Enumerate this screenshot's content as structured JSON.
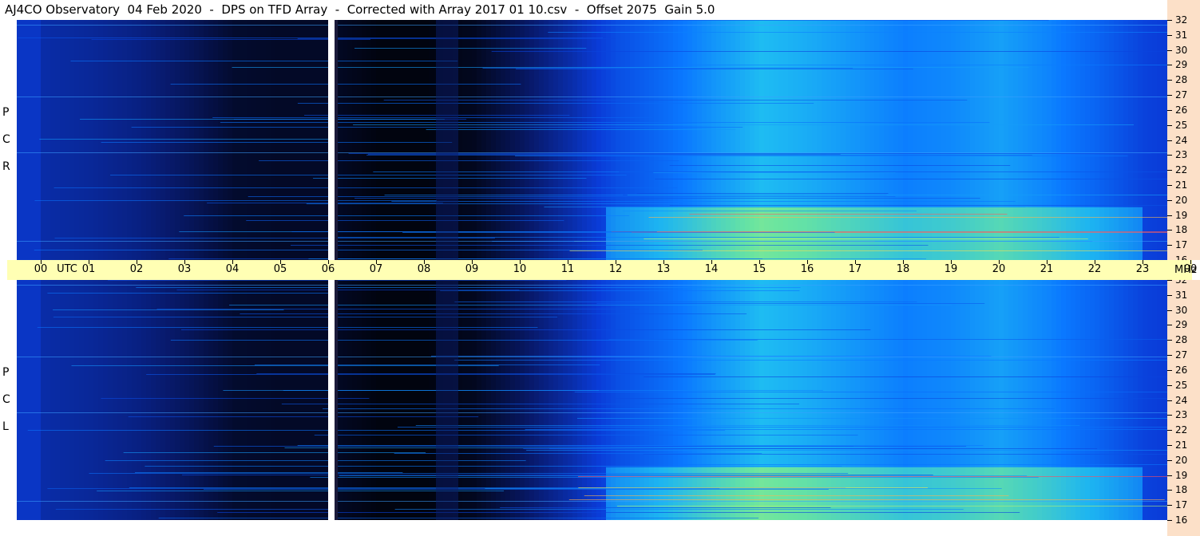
{
  "title": "AJ4CO Observatory  04 Feb 2020  -  DPS on TFD Array  -  Corrected with Array 2017 01 10.csv  -  Offset 2075  Gain 5.0",
  "top_panel": {
    "polarization": [
      "R",
      "C",
      "P"
    ]
  },
  "bottom_panel": {
    "polarization": [
      "L",
      "C",
      "P"
    ]
  },
  "utc_axis": {
    "unit_label": "UTC",
    "ticks": [
      "00",
      "01",
      "02",
      "03",
      "04",
      "05",
      "06",
      "07",
      "08",
      "09",
      "10",
      "11",
      "12",
      "13",
      "14",
      "15",
      "16",
      "17",
      "18",
      "19",
      "20",
      "21",
      "22",
      "23",
      "00"
    ]
  },
  "mhz_axis": {
    "unit_label": "MHz",
    "ticks": [
      "32",
      "31",
      "30",
      "29",
      "28",
      "27",
      "26",
      "25",
      "24",
      "23",
      "22",
      "21",
      "20",
      "19",
      "18",
      "17",
      "16"
    ]
  },
  "chart_data": {
    "type": "heatmap",
    "title": "AJ4CO Observatory  04 Feb 2020  -  DPS on TFD Array  -  Corrected with Array 2017 01 10.csv  -  Offset 2075  Gain 5.0",
    "x_axis": {
      "label": "UTC",
      "range": [
        0,
        24
      ],
      "ticks": [
        "00",
        "01",
        "02",
        "03",
        "04",
        "05",
        "06",
        "07",
        "08",
        "09",
        "10",
        "11",
        "12",
        "13",
        "14",
        "15",
        "16",
        "17",
        "18",
        "19",
        "20",
        "21",
        "22",
        "23",
        "00"
      ]
    },
    "y_axis": {
      "label": "MHz",
      "range": [
        16,
        32
      ],
      "ticks": [
        32,
        31,
        30,
        29,
        28,
        27,
        26,
        25,
        24,
        23,
        22,
        21,
        20,
        19,
        18,
        17,
        16
      ]
    },
    "panels": [
      "RCP",
      "LCP"
    ],
    "colormap": [
      "#000000",
      "#081a6e",
      "#0a3cd8",
      "#0a78ff",
      "#22c8f0",
      "#7cf08c",
      "#f0f050",
      "#ff4060"
    ],
    "data_gap_utc": [
      6.0,
      6.3
    ],
    "intensity_profile_utc": [
      [
        0,
        0.22
      ],
      [
        1,
        0.2
      ],
      [
        2,
        0.17
      ],
      [
        3,
        0.12
      ],
      [
        4,
        0.06
      ],
      [
        5,
        0.05
      ],
      [
        6,
        0.05
      ],
      [
        7,
        0.02
      ],
      [
        8,
        0.02
      ],
      [
        9,
        0.04
      ],
      [
        10,
        0.12
      ],
      [
        11,
        0.22
      ],
      [
        12,
        0.33
      ],
      [
        13,
        0.4
      ],
      [
        14,
        0.48
      ],
      [
        15,
        0.55
      ],
      [
        16,
        0.52
      ],
      [
        17,
        0.48
      ],
      [
        18,
        0.44
      ],
      [
        19,
        0.46
      ],
      [
        20,
        0.5
      ],
      [
        21,
        0.45
      ],
      [
        22,
        0.38
      ],
      [
        23,
        0.3
      ],
      [
        24,
        0.26
      ]
    ]
  }
}
